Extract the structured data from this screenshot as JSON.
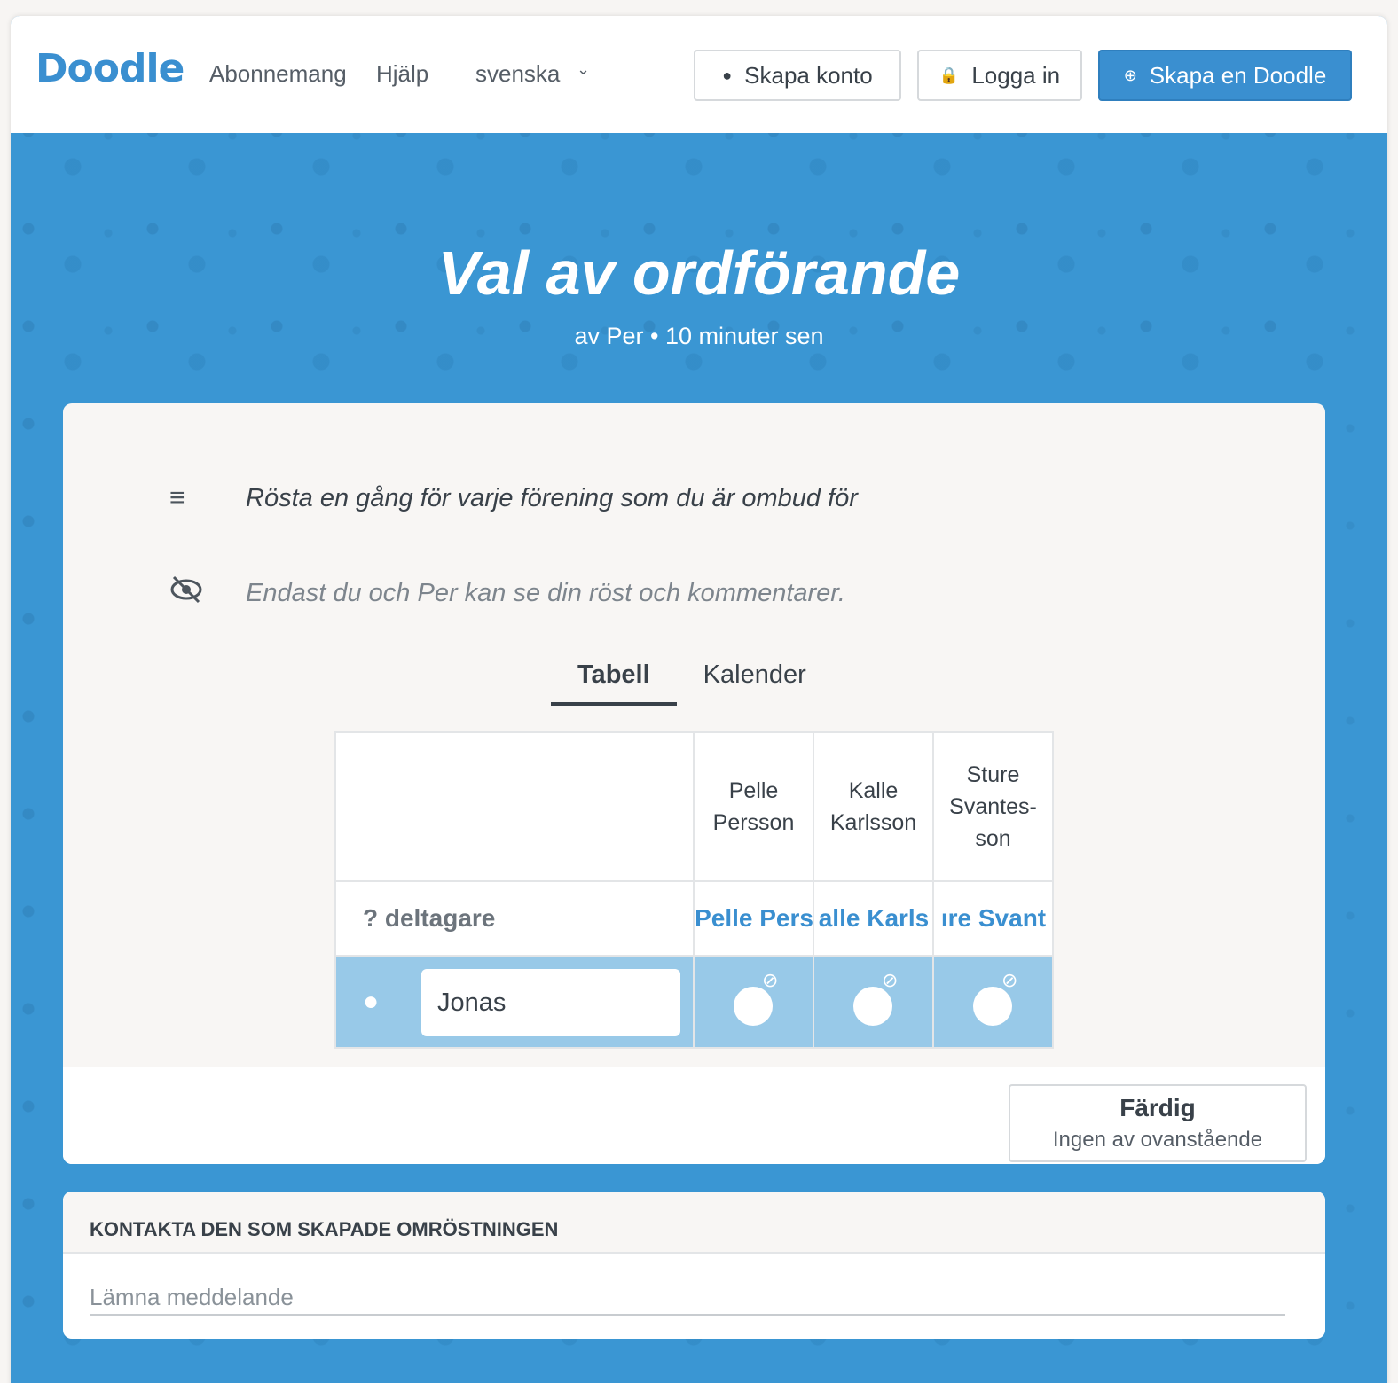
{
  "header": {
    "logo": "Doodle",
    "nav": [
      "Abonnemang",
      "Hjälp"
    ],
    "language": "svenska",
    "create_account": "Skapa konto",
    "login": "Logga in",
    "create_doodle": "Skapa en Doodle"
  },
  "poll": {
    "title": "Val av ordförande",
    "subtitle": "av Per • 10 minuter sen",
    "description": "Rösta en gång för varje förening som du är ombud för",
    "privacy_note": "Endast du och Per kan se din röst och kommentarer."
  },
  "tabs": [
    {
      "label": "Tabell",
      "active": true
    },
    {
      "label": "Kalender",
      "active": false
    }
  ],
  "table": {
    "options": [
      {
        "header": "Pelle\nPersson",
        "summary": "Pelle Pers"
      },
      {
        "header": "Kalle\nKarlsson",
        "summary": "alle Karls"
      },
      {
        "header": "Sture\nSvantes-\nson",
        "summary": "ıre Svant"
      }
    ],
    "participants_label": "? deltagare",
    "user_name": "Jonas"
  },
  "done_button": {
    "title": "Färdig",
    "subtitle": "Ingen av ovanstående"
  },
  "contact": {
    "heading": "KONTAKTA DEN SOM SKAPADE OMRÖSTNINGEN",
    "placeholder": "Lämna meddelande"
  },
  "colors": {
    "brand": "#3a8fd0",
    "background": "#3a96d3",
    "row_highlight": "#98c9e8"
  }
}
